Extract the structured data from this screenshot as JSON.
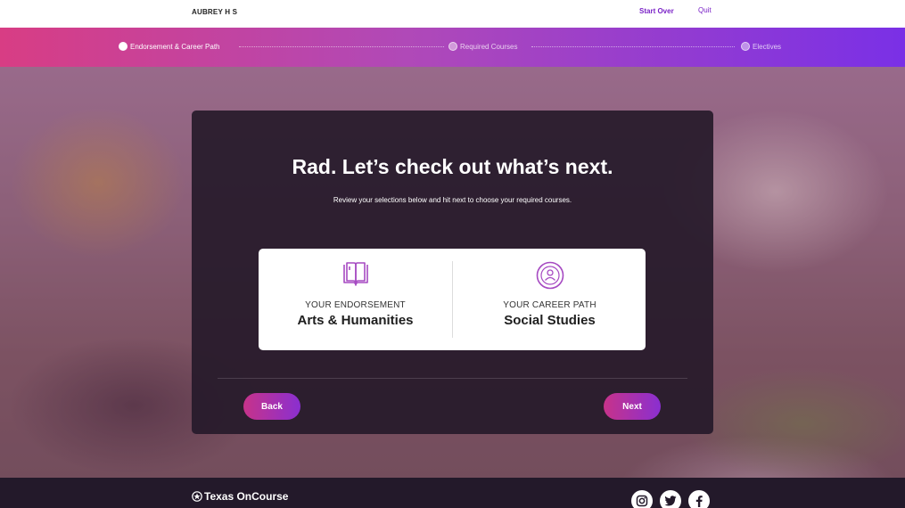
{
  "header": {
    "user_name": "AUBREY H S",
    "start_over_label": "Start Over",
    "quit_label": "Quit"
  },
  "stepper": {
    "steps": [
      {
        "label": "Endorsement & Career Path",
        "state": "active"
      },
      {
        "label": "Required Courses",
        "state": "upcoming"
      },
      {
        "label": "Electives",
        "state": "upcoming"
      }
    ]
  },
  "card": {
    "headline": "Rad. Let’s check out what’s next.",
    "subtext": "Review your selections below and hit next to choose your required courses.",
    "endorsement": {
      "label": "YOUR ENDORSEMENT",
      "value": "Arts & Humanities",
      "icon": "book-icon"
    },
    "career_path": {
      "label": "YOUR CAREER PATH",
      "value": "Social Studies",
      "icon": "person-icon"
    },
    "back_label": "Back",
    "next_label": "Next"
  },
  "footer": {
    "brand": "Texas OnCourse",
    "social": [
      "instagram-icon",
      "twitter-icon",
      "facebook-icon"
    ]
  },
  "colors": {
    "accent_purple": "#7a22c7",
    "gradient_start": "#d83d84",
    "gradient_end": "#7a30e6",
    "card_bg": "#261a2a",
    "footer_bg": "#23192a"
  }
}
